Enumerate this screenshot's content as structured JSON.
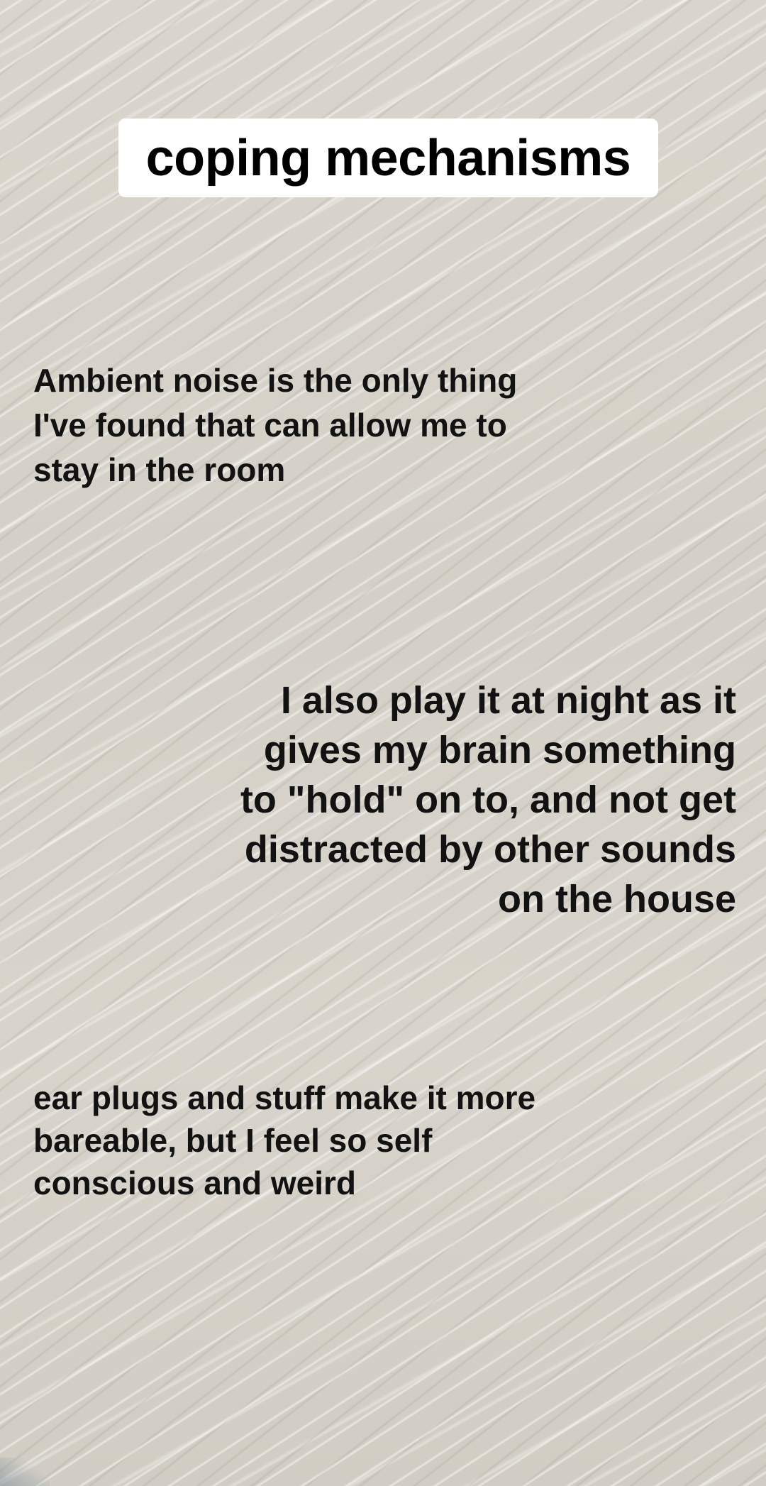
{
  "title": {
    "text": "coping mechanisms"
  },
  "captions": [
    {
      "text": "Ambient noise is the only thing\nI've found that can allow me to\nstay in the room"
    },
    {
      "text": "I also play it at night as it\ngives my brain something\nto \"hold\" on to, and not get\ndistracted by other sounds\non the house"
    },
    {
      "text": "ear plugs and stuff make it more\nbareable, but I feel so self\nconscious and weird"
    }
  ],
  "colors": {
    "background": "#d6d2c9",
    "sticker": "#ffffff",
    "text": "#121212"
  }
}
